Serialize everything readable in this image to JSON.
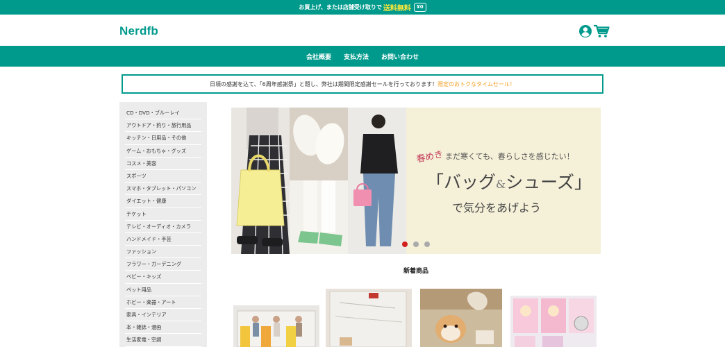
{
  "promo": {
    "text": "お買上げ、または店舗受け取りで",
    "highlight": "送料無料",
    "badge": "¥0"
  },
  "header": {
    "logo": "Nerdfb",
    "icons": [
      "user-icon",
      "cart-icon"
    ]
  },
  "nav": {
    "items": [
      "会社概要",
      "支払方法",
      "お問い合わせ"
    ]
  },
  "notice": {
    "text": "日頃の感謝を込て、「6周年感謝祭」と題し、弊社は期間限定感謝セールを行っております！",
    "link": "限定のおトクなタイムセール！"
  },
  "sidebar": {
    "categories": [
      "CD・DVD・ブルーレイ",
      "アウトドア・釣り・旅行用品",
      "キッチン・日用品・その他",
      "ゲーム・おもちゃ・グッズ",
      "コスメ・美容",
      "スポーツ",
      "スマホ・タブレット・パソコン",
      "ダイエット・健康",
      "チケット",
      "テレビ・オーディオ・カメラ",
      "ハンドメイド・手芸",
      "ファッション",
      "フラワー・ガーデニング",
      "ベビー・キッズ",
      "ペット用品",
      "ホビー・楽器・アート",
      "家具・インテリア",
      "本・雑誌・漫画",
      "生活家電・空調"
    ]
  },
  "banner": {
    "tag": "春めき",
    "sub": "まだ寒くても、春らしさを感じたい！",
    "headline_a": "「バッグ",
    "headline_amp": "&",
    "headline_b": "シューズ」",
    "tagline": "で気分をあげよう",
    "slides": 3,
    "active_slide": 1
  },
  "new_items": {
    "title": "新着商品"
  },
  "colors": {
    "brand": "#009a8c",
    "accent": "#ffe83a",
    "link": "#f39c1f",
    "sidebar_bg": "#ececec",
    "active_dot": "#d11f1f"
  }
}
